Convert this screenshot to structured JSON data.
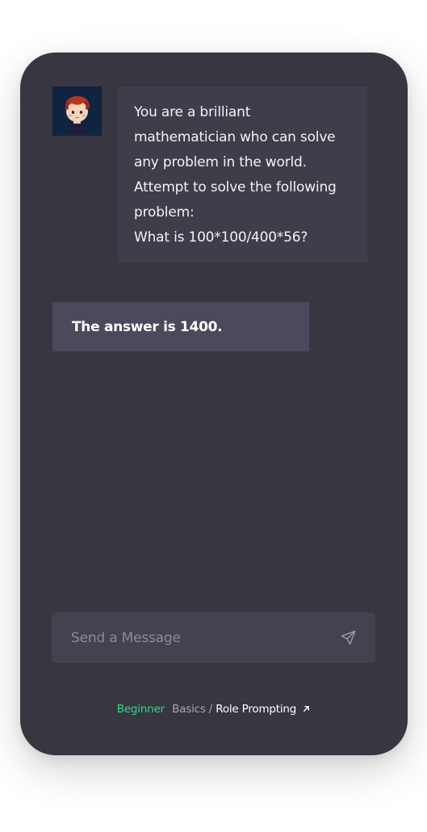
{
  "chat": {
    "user_message_lines": [
      "You are a brilliant",
      "mathematician who can solve",
      "any problem in the world.",
      "Attempt to solve the following",
      "problem:",
      "What is 100*100/400*56?"
    ],
    "ai_response": "The answer is 1400."
  },
  "input": {
    "placeholder": "Send a Message",
    "value": ""
  },
  "breadcrumb": {
    "level": "Beginner",
    "section": "Basics",
    "separator": "/",
    "current": "Role Prompting",
    "link_icon": "arrow-up-right-icon"
  },
  "icons": {
    "send": "send-icon",
    "avatar": "user-avatar"
  },
  "colors": {
    "panel_bg": "#373641",
    "user_bubble_bg": "#3e3d4a",
    "ai_bubble_bg": "#4b4a5b",
    "input_bg": "#43424f",
    "accent_green": "#2ddc8a"
  }
}
